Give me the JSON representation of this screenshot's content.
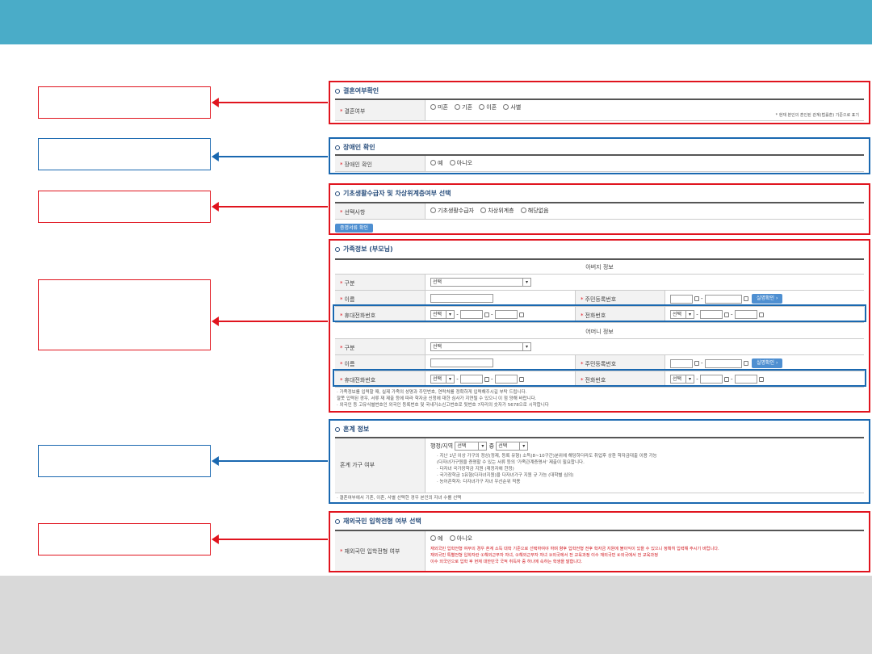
{
  "sections": {
    "marriage": {
      "title": "결혼여부확인",
      "label": "결혼여부",
      "options": [
        "미혼",
        "기혼",
        "이혼",
        "사별"
      ],
      "note": "* 현재 본인의 혼인된 관계(법률혼) 기준으로 표기"
    },
    "disability": {
      "title": "장애인 확인",
      "label": "장애인 확인",
      "options": [
        "예",
        "아니오"
      ]
    },
    "welfare": {
      "title": "기초생활수급자 및 차상위계층여부 선택",
      "label": "선택사항",
      "options": [
        "기초생활수급자",
        "차상위계층",
        "해당없음"
      ],
      "button": "증명서류 확인"
    },
    "family": {
      "title": "가족정보 (부모님)",
      "father_header": "아버지 정보",
      "mother_header": "어머니 정보",
      "field_type": "구분",
      "field_name": "이름",
      "field_ssn": "주민등록번호",
      "field_mobile": "휴대전화번호",
      "field_phone": "전화번호",
      "select_placeholder": "선택",
      "verify_button": "실명확인",
      "notes": [
        "· 가족정보를 입력할 때, 실제 가족의 성명과 주민번호, 연락처를 정확하게 입력해주시길 부탁 드립니다.",
        "  잘못 입력된 경우, 서류 재 제출 등에 따라 학자금 신청에 대한 심사가 지연될 수 있으니 이 점 양해 바랍니다.",
        "· 외국인 등 고유식별번호인 외국인 등록번호 및 국내거소신고번호로 뒷번호 7자리의 숫자가 5678으로 시작합니다"
      ]
    },
    "household": {
      "title": "혼계 정보",
      "label": "혼계 가구 여부",
      "region_label": "행정/지역",
      "select1": "선택",
      "select_mid": "중",
      "select2": "선택",
      "notes": [
        "· 지난 1년 이상 가구의 정상(정제, 등록 유형) 소득(8~10구간)분위에 해당하더라도 취업후 상환 학자금대출 이용 가능",
        "  (다자녀가구원을 증명할 수 있는 서류 등의 '가족관계증명서' 제출이 필요합니다.",
        "· 다자녀 국가장학금 지원 (재정자애 한정)",
        "· 국가장학금 1유형(다자녀지원)을 다자녀가구 지원 규 가능 (대학별 심의)",
        "· 농어촌학자: 다자녀가구 자녀 우선순위 적용"
      ],
      "footer_note": "· 결혼여부에서 기혼, 이혼, 사별 선택한 경우 본인의 자녀 수를 선택"
    },
    "overseas": {
      "title": "재외국민 입학전형 여부 선택",
      "label": "재외국민 입학전형 여부",
      "options": [
        "예",
        "아니오"
      ],
      "notes": [
        "재외국민 입학전형 여부의 경우 혼계 소득 대학 기준으로 선택하여야 하며 향후 입학전형 전후 학자금 지원에 불이익이 있을 수 있으니 정확히 입력해 주시기 바랍니다.",
        "재외국민 특별전형 입학자란 ①해외근무자 자녀, ②해외근무자 자녀 ③외국에서 전 교육과정 이수 재외국민 ④외국에서 전 교육과정",
        "이수 외국인으로 입학 후 현재 대한민국 국적 취득자 중 하나에 속하는 학생을 말합니다."
      ]
    }
  },
  "colors": {
    "top_bar": "#4aacc8",
    "bottom_bar": "#d9d9d9",
    "red": "#e0141e",
    "blue": "#1a68b0"
  }
}
